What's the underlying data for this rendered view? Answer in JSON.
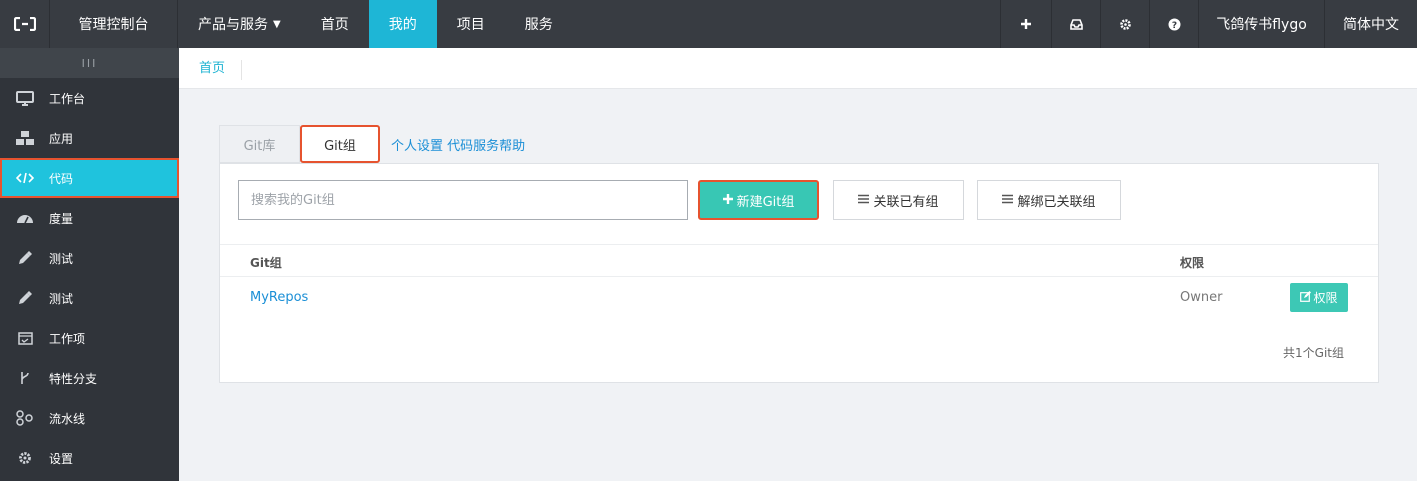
{
  "topbar": {
    "logo_icon": "aliyun-logo-icon",
    "console_label": "管理控制台",
    "nav": [
      {
        "label": "产品与服务"
      },
      {
        "label": "首页"
      },
      {
        "label": "我的"
      },
      {
        "label": "项目"
      },
      {
        "label": "服务"
      }
    ],
    "right": {
      "add_icon": "plus-icon",
      "inbox_icon": "inbox-icon",
      "settings_icon": "gear-icon",
      "help_icon": "question-icon",
      "user": "飞鸽传书flygo",
      "language": "简体中文"
    }
  },
  "sidebar": {
    "collapse_label": "III",
    "items": [
      {
        "label": "工作台",
        "icon": "monitor-icon"
      },
      {
        "label": "应用",
        "icon": "cubes-icon"
      },
      {
        "label": "代码",
        "icon": "code-icon"
      },
      {
        "label": "度量",
        "icon": "dashboard-icon"
      },
      {
        "label": "测试",
        "icon": "eyedropper-icon"
      },
      {
        "label": "测试",
        "icon": "eyedropper-icon"
      },
      {
        "label": "工作项",
        "icon": "calendar-check-icon"
      },
      {
        "label": "特性分支",
        "icon": "branch-icon"
      },
      {
        "label": "流水线",
        "icon": "pipeline-icon"
      },
      {
        "label": "设置",
        "icon": "gear-icon"
      }
    ]
  },
  "breadcrumb": {
    "home": "首页"
  },
  "tabs": [
    {
      "label": "Git库"
    },
    {
      "label": "Git组"
    }
  ],
  "tab_links": {
    "personal": "个人设置",
    "help": "代码服务帮助"
  },
  "toolbar": {
    "search_placeholder": "搜索我的Git组",
    "new_label": "新建Git组",
    "link_label": "关联已有组",
    "unbind_label": "解绑已关联组"
  },
  "table": {
    "headers": {
      "group": "Git组",
      "permission": "权限"
    },
    "rows": [
      {
        "name": "MyRepos",
        "permission": "Owner",
        "action": "权限"
      }
    ],
    "total": "共1个Git组"
  }
}
